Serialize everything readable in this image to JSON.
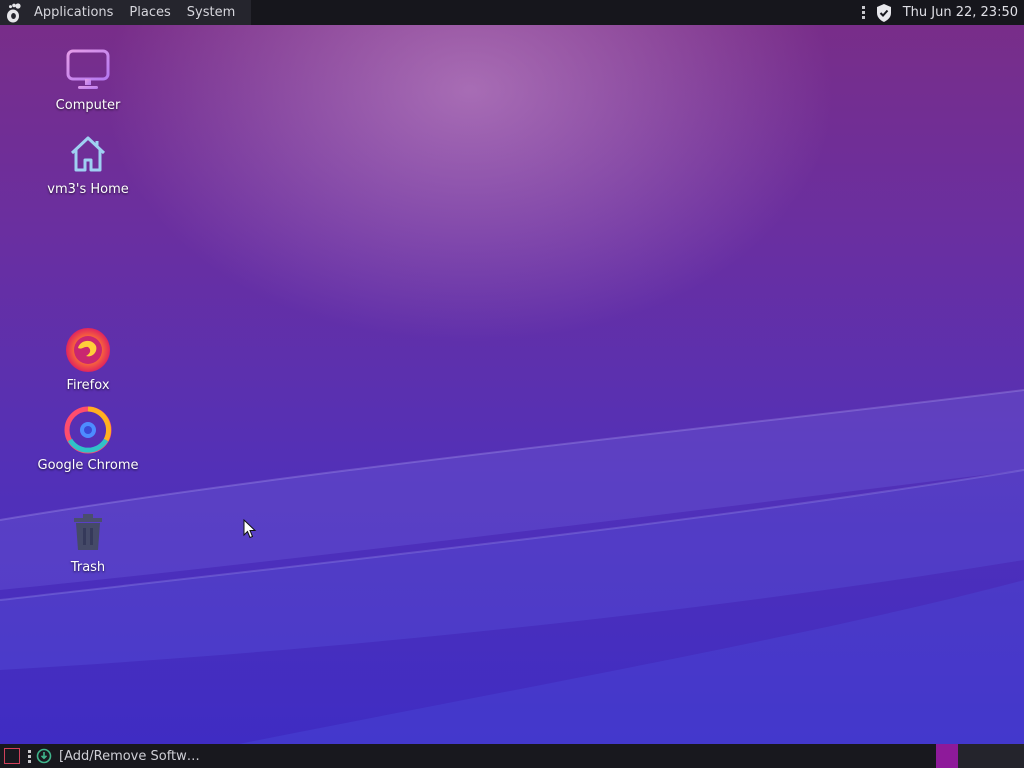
{
  "top_panel": {
    "menus": [
      {
        "label": "Applications"
      },
      {
        "label": "Places"
      },
      {
        "label": "System"
      }
    ],
    "clock": "Thu Jun 22, 23:50",
    "indicators": [
      "panel-handle-icon",
      "shield-check-icon"
    ]
  },
  "desktop": {
    "icons": [
      {
        "label": "Computer",
        "icon": "monitor-icon"
      },
      {
        "label": "vm3's Home",
        "icon": "home-icon"
      },
      {
        "label": "Firefox",
        "icon": "firefox-icon"
      },
      {
        "label": "Google Chrome",
        "icon": "chrome-icon"
      },
      {
        "label": "Trash",
        "icon": "trash-icon"
      }
    ]
  },
  "bottom_panel": {
    "tasks": [
      {
        "label": "[Add/Remove Softw…",
        "icon": "software-install-icon"
      }
    ],
    "workspaces": [
      {
        "active": true,
        "color": "#8e1a9a"
      },
      {
        "active": false,
        "color": "#24242c"
      }
    ]
  },
  "colors": {
    "panel": "#16161c",
    "accent": "#8e1a9a",
    "wallpaper_top": "#7a2d86",
    "wallpaper_bottom": "#3d2cc4"
  }
}
